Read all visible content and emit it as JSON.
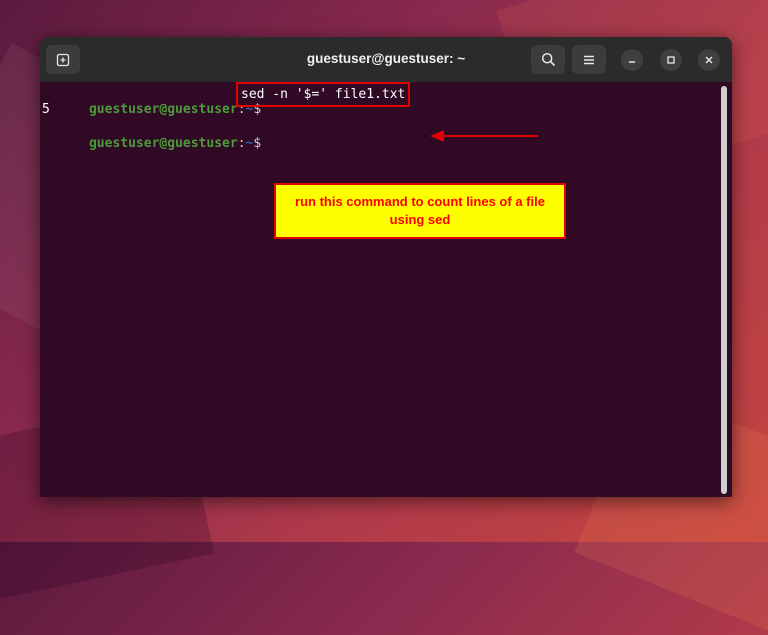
{
  "window": {
    "title": "guestuser@guestuser: ~"
  },
  "icons": {
    "new_tab": "new-tab-icon",
    "search": "search-icon",
    "menu": "hamburger-menu-icon",
    "minimize": "minimize-icon",
    "maximize": "maximize-icon",
    "close": "close-icon"
  },
  "terminal": {
    "lines": [
      {
        "user": "guestuser@guestuser",
        "sep": ":",
        "path": "~",
        "symbol": "$ ",
        "command": "sed -n '$=' file1.txt"
      },
      {
        "output": "5"
      },
      {
        "user": "guestuser@guestuser",
        "sep": ":",
        "path": "~",
        "symbol": "$",
        "command": ""
      }
    ]
  },
  "annotation": {
    "callout_text": "run this command to count lines of a file using sed"
  },
  "colors": {
    "terminal_bg": "#300a24",
    "titlebar_bg": "#2b2b2b",
    "prompt_user": "#4e9a3a",
    "prompt_path": "#3465a4",
    "annotation_red": "#e00000",
    "callout_bg": "#ffff00"
  }
}
